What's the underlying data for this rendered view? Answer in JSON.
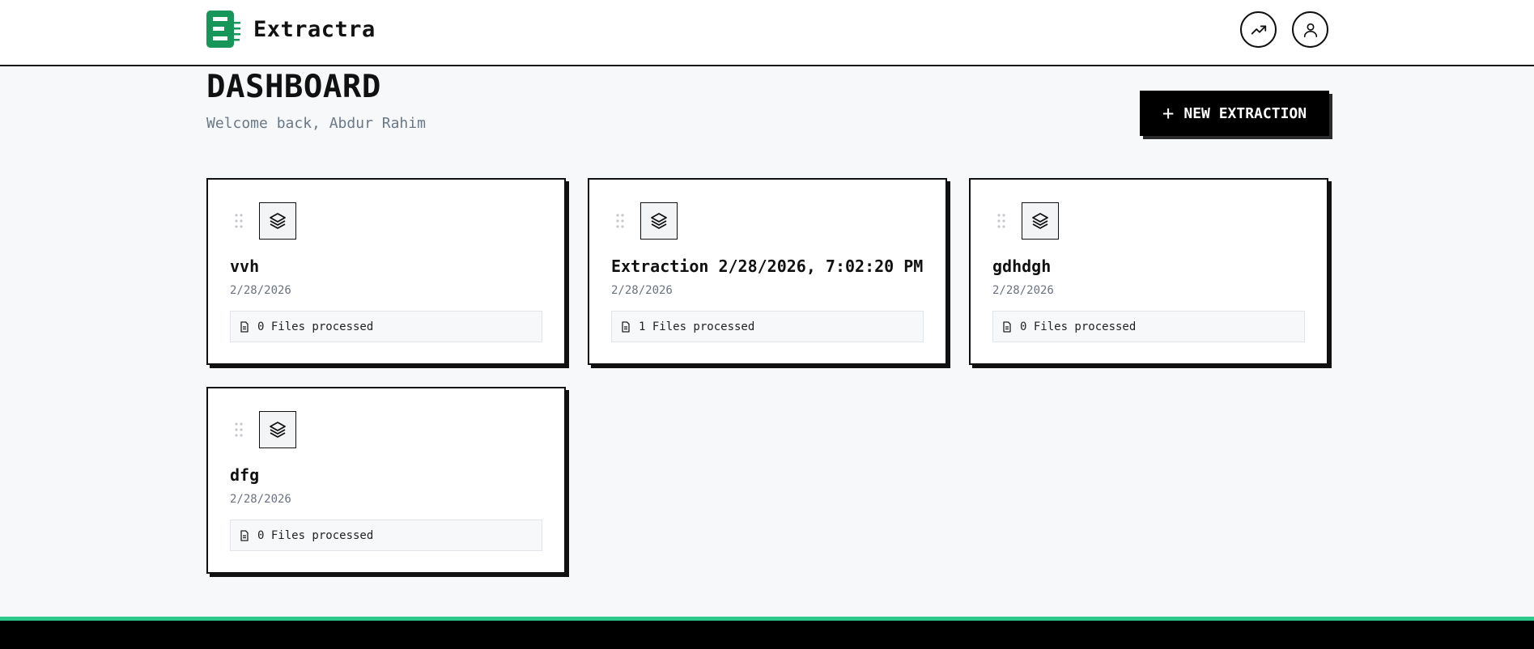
{
  "brand": {
    "name": "Extractra",
    "color": "#17965a"
  },
  "header": {
    "trend_icon": "trending-up-icon",
    "user_icon": "user-icon"
  },
  "dashboard": {
    "title": "DASHBOARD",
    "welcome": "Welcome back, Abdur Rahim",
    "new_button": {
      "icon": "+",
      "label": "NEW EXTRACTION"
    }
  },
  "extractions": [
    {
      "title": "vvh",
      "date": "2/28/2026",
      "files": "0 Files processed"
    },
    {
      "title": "Extraction 2/28/2026, 7:02:20 PM",
      "date": "2/28/2026",
      "files": "1 Files processed"
    },
    {
      "title": "gdhdgh",
      "date": "2/28/2026",
      "files": "0 Files processed"
    },
    {
      "title": "dfg",
      "date": "2/28/2026",
      "files": "0 Files processed"
    }
  ],
  "colors": {
    "accent": "#2ec98a",
    "background": "#f6f8fa",
    "ink": "#111111"
  }
}
